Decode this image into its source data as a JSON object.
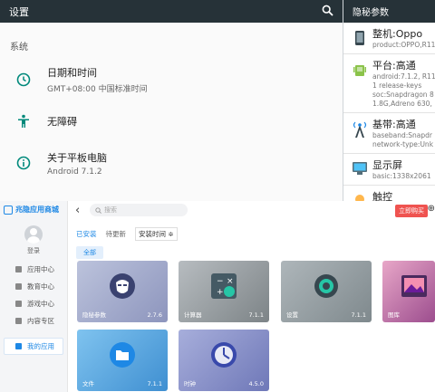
{
  "settings": {
    "title": "设置",
    "section": "系统",
    "rows": [
      {
        "title": "日期和时间",
        "sub": "GMT+08:00 中国标准时间"
      },
      {
        "title": "无障碍",
        "sub": ""
      },
      {
        "title": "关于平板电脑",
        "sub": "Android 7.1.2"
      }
    ]
  },
  "params": {
    "title": "隐秘参数",
    "items": [
      {
        "title": "整机:Oppo",
        "lines": [
          "product:OPPO,R11"
        ]
      },
      {
        "title": "平台:高通",
        "lines": [
          "android:7.1.2, R11",
          "1 release-keys",
          "soc:Snapdragon 8",
          "1.8G,Adreno 630,"
        ]
      },
      {
        "title": "基带:高通",
        "lines": [
          "baseband:Snapdr",
          "network-type:Unk"
        ]
      },
      {
        "title": "显示屏",
        "lines": [
          "basic:1338x2061"
        ]
      },
      {
        "title": "触控",
        "lines": []
      }
    ]
  },
  "store": {
    "brand": "兆隐应用商城",
    "login": "登录",
    "nav": [
      "应用中心",
      "教育中心",
      "游戏中心",
      "内容专区"
    ],
    "my_apps": "我的应用",
    "search_placeholder": "搜索",
    "buy": "立即购买",
    "tabs": [
      "已安装",
      "待更新"
    ],
    "sort": "安装时间 ≑",
    "chip": "全部",
    "apps": [
      {
        "name": "隐秘参数",
        "version": "2.7.6"
      },
      {
        "name": "计算器",
        "version": "7.1.1"
      },
      {
        "name": "设置",
        "version": "7.1.1"
      },
      {
        "name": "图库",
        "version": ""
      },
      {
        "name": "文件",
        "version": "7.1.1"
      },
      {
        "name": "时钟",
        "version": "4.5.0"
      }
    ]
  }
}
